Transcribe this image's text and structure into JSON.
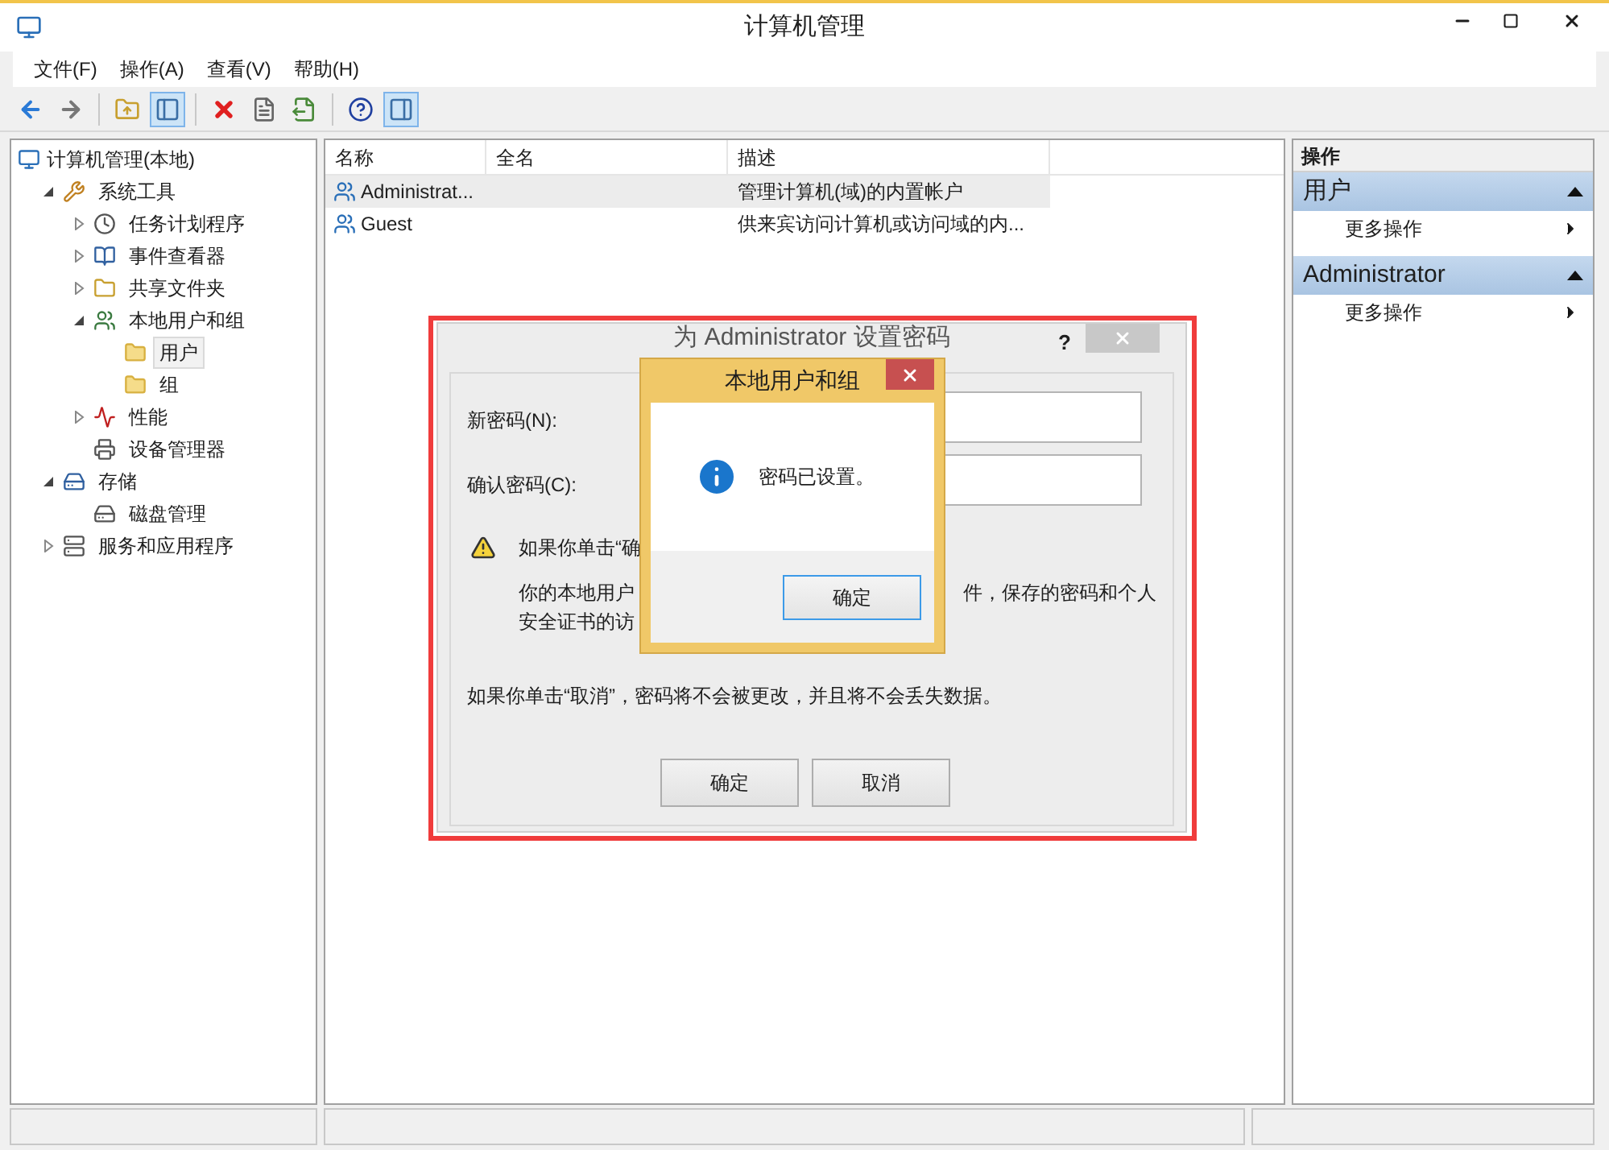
{
  "window": {
    "title": "计算机管理"
  },
  "menu": [
    "文件(F)",
    "操作(A)",
    "查看(V)",
    "帮助(H)"
  ],
  "toolbar": [
    {
      "pressed": false
    },
    {
      "pressed": false
    },
    {
      "pressed": false
    },
    {
      "pressed": true
    },
    {
      "pressed": false
    },
    {
      "pressed": false
    },
    {
      "pressed": false
    },
    {
      "pressed": false
    },
    {
      "pressed": true
    }
  ],
  "tree": {
    "label": "计算机管理(本地)",
    "children": [
      {
        "label": "系统工具",
        "expanded": true,
        "selected": false,
        "children": [
          {
            "label": "任务计划程序",
            "expanded": false,
            "selected": false
          },
          {
            "label": "事件查看器",
            "expanded": false,
            "selected": false
          },
          {
            "label": "共享文件夹",
            "expanded": false,
            "selected": false
          },
          {
            "label": "本地用户和组",
            "expanded": true,
            "selected": false,
            "children": [
              {
                "label": "用户",
                "selected": true
              },
              {
                "label": "组",
                "selected": false
              }
            ]
          },
          {
            "label": "性能",
            "expanded": false,
            "selected": false
          },
          {
            "label": "设备管理器",
            "selected": false
          }
        ]
      },
      {
        "label": "存储",
        "expanded": true,
        "selected": false,
        "children": [
          {
            "label": "磁盘管理",
            "selected": false
          }
        ]
      },
      {
        "label": "服务和应用程序",
        "expanded": false,
        "selected": false
      }
    ]
  },
  "table": {
    "columns": [
      "名称",
      "全名",
      "描述"
    ],
    "rows": [
      {
        "name": "Administrat...",
        "description": "管理计算机(域)的内置帐户",
        "selected": true
      },
      {
        "name": "Guest",
        "description": "供来宾访问计算机或访问域的内...",
        "selected": false
      }
    ]
  },
  "actions": {
    "title": "操作",
    "sections": [
      {
        "title": "用户",
        "expanded": true,
        "items": [
          "更多操作"
        ]
      },
      {
        "title": "Administrator",
        "expanded": true,
        "items": [
          "更多操作"
        ]
      }
    ]
  },
  "password_dialog": {
    "title": "为 Administrator 设置密码",
    "new_password_label": "新密码(N):",
    "confirm_password_label": "确认密码(C):",
    "warning_visible": "如果你单击“确",
    "body_line1_left": "你的本地用户",
    "body_line1_right": "件，保存的密码和个人",
    "body_line2_left": "安全证书的访",
    "cancel_note": "如果你单击“取消”，密码将不会被更改，并且将不会丢失数据。",
    "buttons": [
      "确定",
      "取消"
    ],
    "help": "?"
  },
  "message_box": {
    "title": "本地用户和组",
    "message": "密码已设置。",
    "button": "确定"
  }
}
